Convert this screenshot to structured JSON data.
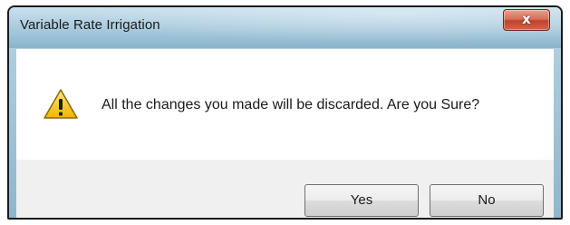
{
  "window": {
    "title": "Variable Rate Irrigation",
    "close_icon": "close-icon",
    "close_glyph": "x"
  },
  "dialog": {
    "icon": "warning-icon",
    "message": "All the changes you made will be discarded. Are you Sure?"
  },
  "buttons": {
    "yes_label": "Yes",
    "no_label": "No"
  },
  "colors": {
    "titlebar": "#a7c9dc",
    "close_button": "#c0432c",
    "warning_yellow": "#f5c518"
  }
}
